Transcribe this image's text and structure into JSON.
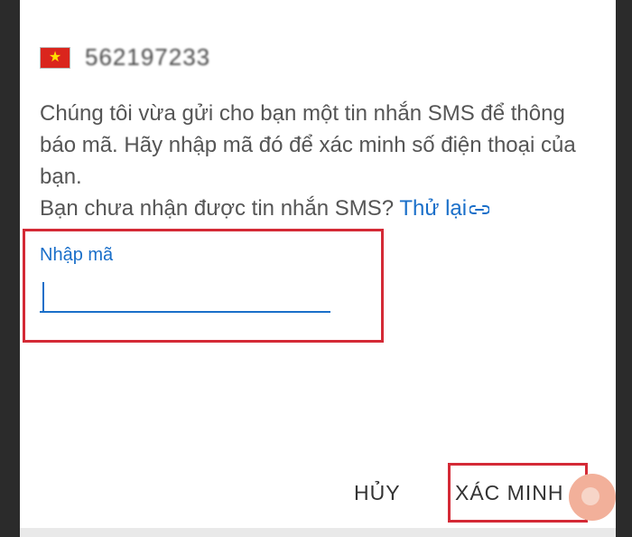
{
  "phone": {
    "flag_icon": "vietnam-flag-icon",
    "flag_star": "★",
    "number": "562197233"
  },
  "message": {
    "line1": "Chúng tôi vừa gửi cho bạn một tin nhắn SMS để thông báo mã. Hãy nhập mã đó để xác minh số điện thoại của bạn.",
    "prompt": "Bạn chưa nhận được tin nhắn SMS?",
    "retry_label": "Thử lại",
    "retry_icon": "link-icon"
  },
  "code_field": {
    "label": "Nhập mã",
    "value": ""
  },
  "actions": {
    "cancel_label": "HỦY",
    "verify_label": "XÁC MINH"
  },
  "colors": {
    "accent": "#1a6fc9",
    "highlight_box": "#d42a36",
    "text": "#555555"
  }
}
